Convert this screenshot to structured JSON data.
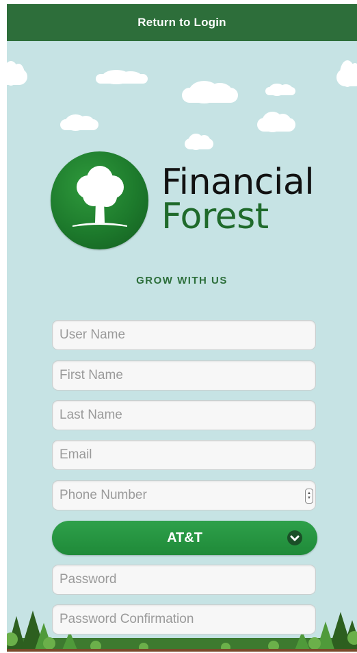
{
  "header": {
    "return_label": "Return to Login"
  },
  "logo": {
    "line1": "Financial",
    "line2": "Forest"
  },
  "tagline": "GROW WITH US",
  "form": {
    "username_placeholder": "User Name",
    "firstname_placeholder": "First Name",
    "lastname_placeholder": "Last Name",
    "email_placeholder": "Email",
    "phone_placeholder": "Phone Number",
    "carrier_selected": "AT&T",
    "password_placeholder": "Password",
    "password_confirm_placeholder": "Password Confirmation"
  },
  "icons": {
    "tree": "tree-icon",
    "chevron": "chevron-down-icon",
    "stepper": "stepper-icon"
  },
  "colors": {
    "header": "#2d6e3a",
    "background": "#c6e3e4",
    "accent": "#1f8a39",
    "logo_text": "#1f6a2b"
  }
}
